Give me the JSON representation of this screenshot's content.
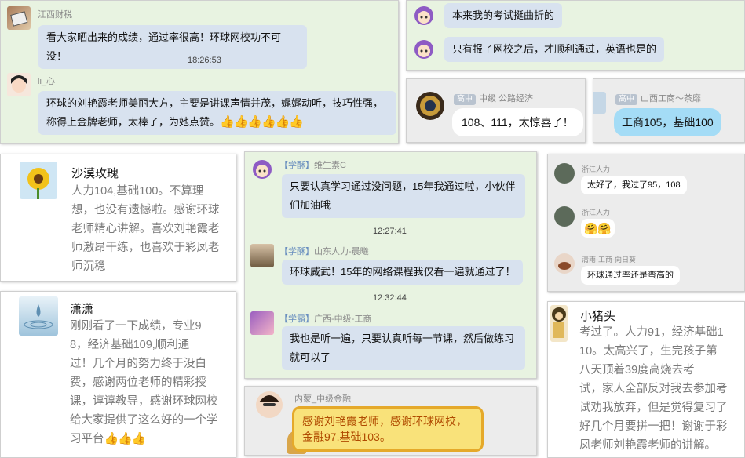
{
  "card1": {
    "user1_name": "江西财税",
    "msg1": "看大家晒出来的成绩，通过率很高！环球网校功不可没！",
    "time": "18:26:53",
    "user2_name": "li_心",
    "msg2_line1": "环球的刘艳霞老师美丽大方，主要是讲课声情并茂，娓娓动听，技巧性强，",
    "msg2_line2": "称得上金牌老师，太棒了，为她点赞。",
    "thumbs": "👍👍👍👍👍👍"
  },
  "card2": {
    "msg1": "本来我的考试挺曲折的",
    "msg2": "只有报了网校之后，才顺利通过，英语也是的"
  },
  "card3": {
    "badge": "高中",
    "name": "中级 公路经济",
    "msg": "108、111，太惊喜了！"
  },
  "card4": {
    "badge": "高中",
    "name": "山西工商～茶靡",
    "msg": "工商105，基础100"
  },
  "card5": {
    "name": "沙漠玫瑰",
    "lines": [
      "人力104,基础100。不算理",
      "想，也没有遗憾啦。感谢环球",
      "老师精心讲解。喜欢刘艳霞老",
      "师激昂干练，也喜欢于彩凤老",
      "师沉稳"
    ]
  },
  "card6": {
    "user1_tag": "【学酥】",
    "user1_name": "维生素C",
    "msg1_line1": "只要认真学习通过没问题，15年我通过啦，小伙伴",
    "msg1_line2": "们加油哦",
    "time1": "12:27:41",
    "user2_tag": "【学酥】",
    "user2_name": "山东人力-晨曦",
    "msg2": "环球威武！15年的网络课程我仅看一遍就通过了！",
    "time2": "12:32:44",
    "user3_tag": "【学霸】",
    "user3_name": "广西-中级-工商",
    "msg3_line1": "我也是听一遍，只要认真听每一节课，然后做练习",
    "msg3_line2": "就可以了"
  },
  "card7": {
    "user1_name": "浙江人力",
    "msg1": "太好了，我过了95，108",
    "user2_name": "浙江人力",
    "msg2": "🤗🤗",
    "user3_name": "清雨-工商-向日葵",
    "msg3": "环球通过率还是蛮高的"
  },
  "card8": {
    "name": "潇潇",
    "lines": [
      "刚刚看了一下成绩，专业9",
      "8，经济基础109,顺利通",
      "过！几个月的努力终于没白",
      "费，感谢两位老师的精彩授",
      "课，谆谆教导，感谢环球网校",
      "给大家提供了这么好的一个学",
      "习平台"
    ],
    "thumbs": "👍👍👍"
  },
  "card9": {
    "name": "内蒙_中级金融",
    "msg_line1": "感谢刘艳霞老师，感谢环球网校，",
    "msg_line2": "金融97.基础103。"
  },
  "card10": {
    "name": "小猪头",
    "lines": [
      "考过了。人力91，经济基础1",
      "10。太高兴了，生完孩子第",
      "八天顶着39度高烧去考",
      "试，家人全部反对我去参加考",
      "试劝我放弃，但是觉得复习了",
      "好几个月要拼一把！谢谢于彩",
      "凤老师刘艳霞老师的讲解。"
    ]
  }
}
